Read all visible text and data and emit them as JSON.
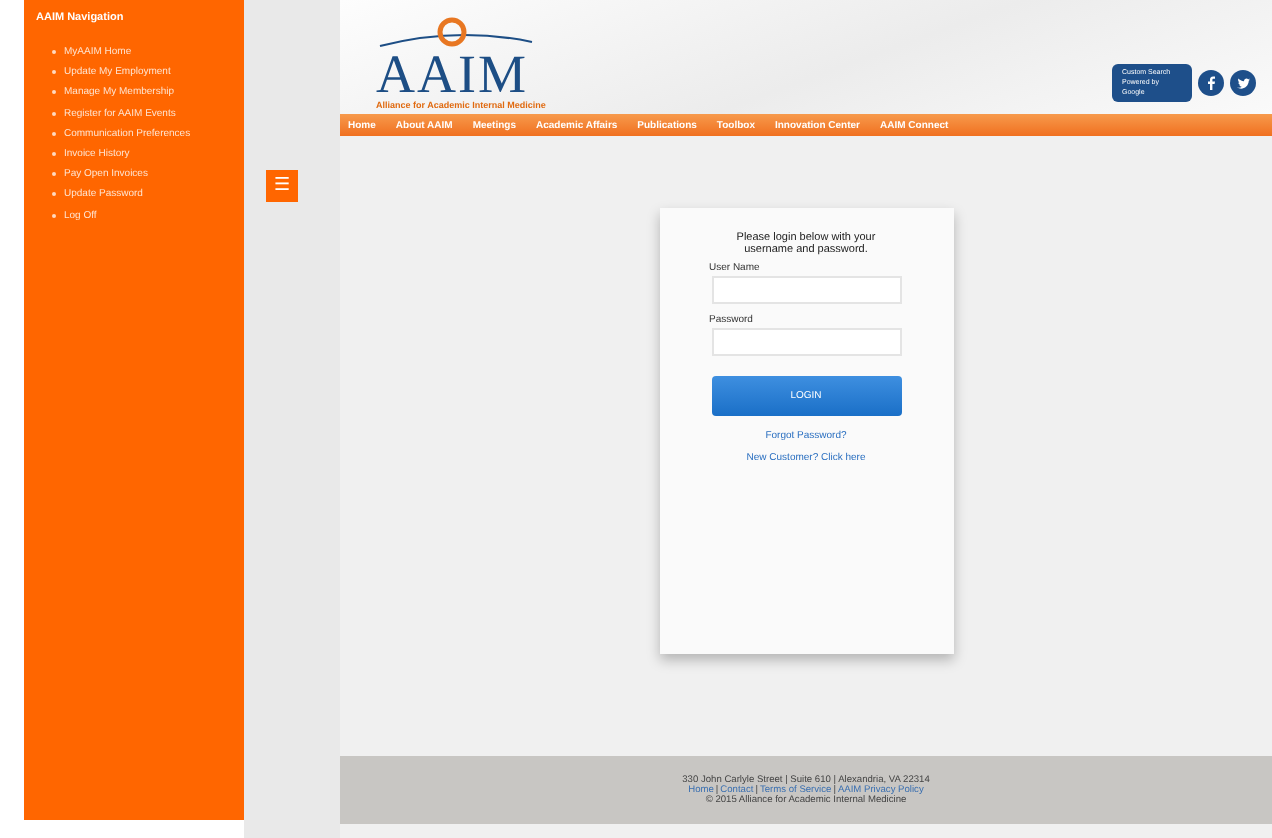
{
  "sidebar": {
    "title": "AAIM Navigation",
    "items": [
      {
        "label": "MyAAIM Home"
      },
      {
        "label": "Update My Employment"
      },
      {
        "label": "Manage My Membership"
      },
      {
        "label": "Register for AAIM Events"
      },
      {
        "label": "Communication Preferences"
      },
      {
        "label": "Invoice History"
      },
      {
        "label": "Pay Open Invoices"
      },
      {
        "label": "Update Password"
      },
      {
        "label": "Log Off"
      }
    ]
  },
  "menu_button": {
    "icon": "☰"
  },
  "header": {
    "logo": "AAIM",
    "tagline": "Alliance for Academic Internal Medicine",
    "search_badge": {
      "line_1": "Custom Search",
      "line_2": "Powered by Google"
    },
    "nav": [
      {
        "label": "Home"
      },
      {
        "label": "About AAIM"
      },
      {
        "label": "Meetings"
      },
      {
        "label": "Academic Affairs"
      },
      {
        "label": "Publications"
      },
      {
        "label": "Toolbox"
      },
      {
        "label": "Innovation Center"
      },
      {
        "label": "AAIM Connect"
      }
    ]
  },
  "login": {
    "intro": "Please login below with your username and password.",
    "username_label": "User Name",
    "password_label": "Password",
    "button": "LOGIN",
    "forgot_link": "Forgot Password?",
    "new_customer_link": "New Customer? Click here"
  },
  "footer": {
    "address": "330 John Carlyle Street | Suite 610 | Alexandria, VA 22314",
    "link_separator": "|",
    "links": [
      {
        "label": "Home"
      },
      {
        "label": "Contact"
      },
      {
        "label": "Terms of Service"
      },
      {
        "label": "AAIM Privacy Policy"
      }
    ],
    "copyright": "© 2015 Alliance for Academic Internal Medicine"
  }
}
